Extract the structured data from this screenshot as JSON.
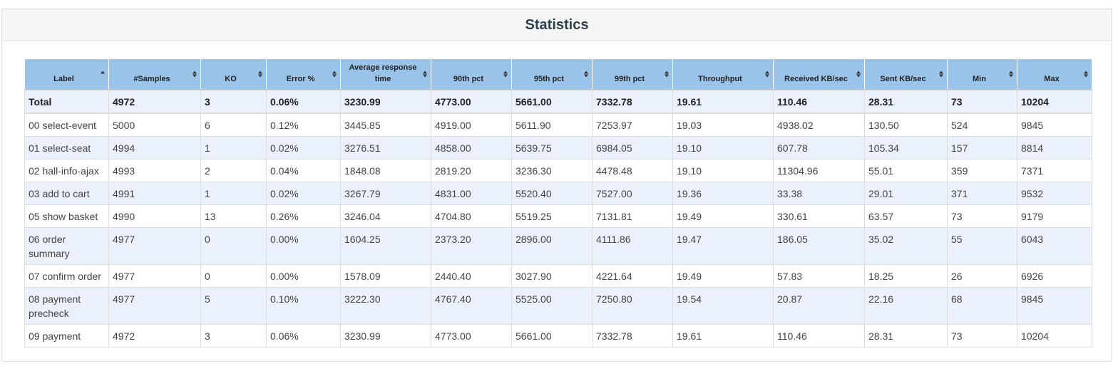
{
  "panel": {
    "title": "Statistics"
  },
  "columns": [
    {
      "label": "Label",
      "sort": "asc"
    },
    {
      "label": "#Samples",
      "sort": "both"
    },
    {
      "label": "KO",
      "sort": "both"
    },
    {
      "label": "Error %",
      "sort": "both"
    },
    {
      "label": "Average response time",
      "sort": "both"
    },
    {
      "label": "90th pct",
      "sort": "both"
    },
    {
      "label": "95th pct",
      "sort": "both"
    },
    {
      "label": "99th pct",
      "sort": "both"
    },
    {
      "label": "Throughput",
      "sort": "both"
    },
    {
      "label": "Received KB/sec",
      "sort": "both"
    },
    {
      "label": "Sent KB/sec",
      "sort": "both"
    },
    {
      "label": "Min",
      "sort": "both"
    },
    {
      "label": "Max",
      "sort": "both"
    }
  ],
  "total": [
    "Total",
    "4972",
    "3",
    "0.06%",
    "3230.99",
    "4773.00",
    "5661.00",
    "7332.78",
    "19.61",
    "110.46",
    "28.31",
    "73",
    "10204"
  ],
  "rows": [
    [
      "00 select-event",
      "5000",
      "6",
      "0.12%",
      "3445.85",
      "4919.00",
      "5611.90",
      "7253.97",
      "19.03",
      "4938.02",
      "130.50",
      "524",
      "9845"
    ],
    [
      "01 select-seat",
      "4994",
      "1",
      "0.02%",
      "3276.51",
      "4858.00",
      "5639.75",
      "6984.05",
      "19.10",
      "607.78",
      "105.34",
      "157",
      "8814"
    ],
    [
      "02 hall-info-ajax",
      "4993",
      "2",
      "0.04%",
      "1848.08",
      "2819.20",
      "3236.30",
      "4478.48",
      "19.10",
      "11304.96",
      "55.01",
      "359",
      "7371"
    ],
    [
      "03 add to cart",
      "4991",
      "1",
      "0.02%",
      "3267.79",
      "4831.00",
      "5520.40",
      "7527.00",
      "19.36",
      "33.38",
      "29.01",
      "371",
      "9532"
    ],
    [
      "05 show basket",
      "4990",
      "13",
      "0.26%",
      "3246.04",
      "4704.80",
      "5519.25",
      "7131.81",
      "19.49",
      "330.61",
      "63.57",
      "73",
      "9179"
    ],
    [
      "06 order summary",
      "4977",
      "0",
      "0.00%",
      "1604.25",
      "2373.20",
      "2896.00",
      "4111.86",
      "19.47",
      "186.05",
      "35.02",
      "55",
      "6043"
    ],
    [
      "07 confirm order",
      "4977",
      "0",
      "0.00%",
      "1578.09",
      "2440.40",
      "3027.90",
      "4221.64",
      "19.49",
      "57.83",
      "18.25",
      "26",
      "6926"
    ],
    [
      "08 payment precheck",
      "4977",
      "5",
      "0.10%",
      "3222.30",
      "4767.40",
      "5525.00",
      "7250.80",
      "19.54",
      "20.87",
      "22.16",
      "68",
      "9845"
    ],
    [
      "09 payment",
      "4972",
      "3",
      "0.06%",
      "3230.99",
      "4773.00",
      "5661.00",
      "7332.78",
      "19.61",
      "110.46",
      "28.31",
      "73",
      "10204"
    ]
  ]
}
